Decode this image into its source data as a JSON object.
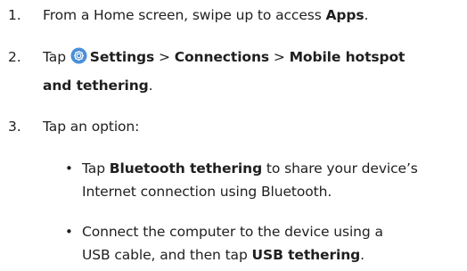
{
  "steps": [
    {
      "number": "1.",
      "prefix": "From a Home screen, swipe up to access ",
      "bold": "Apps",
      "suffix": "."
    },
    {
      "number": "2.",
      "tap": "Tap",
      "settings": "Settings",
      "sep1": ">",
      "connections": "Connections",
      "sep2": ">",
      "hotspot_a": "Mobile hotspot",
      "hotspot_b": "and tethering",
      "suffix": "."
    },
    {
      "number": "3.",
      "text": "Tap an option:"
    }
  ],
  "options": [
    {
      "bullet": "•",
      "tap": "Tap ",
      "bold": "Bluetooth tethering",
      "rest1": " to share your device’s",
      "line2": "Internet connection using Bluetooth."
    },
    {
      "bullet": "•",
      "line1": "Connect the computer to the device using a",
      "line2_prefix": "USB cable, and then tap ",
      "bold": "USB tethering",
      "suffix": "."
    }
  ],
  "icons": {
    "settings": "settings-gear-icon",
    "settings_color": "#4a90d9"
  }
}
